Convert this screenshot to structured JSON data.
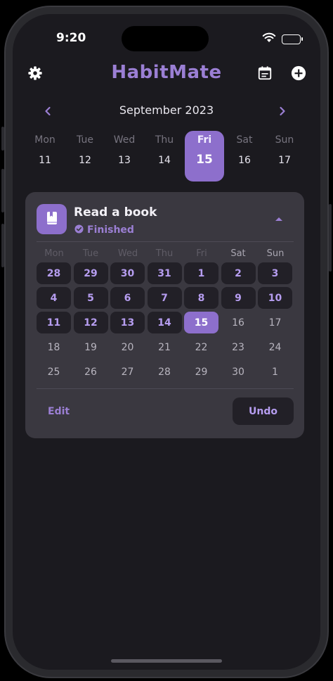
{
  "status_bar": {
    "time": "9:20"
  },
  "header": {
    "title": "HabitMate",
    "left_icon": "gear-icon",
    "right_icons": [
      "calendar-icon",
      "plus-circle-icon"
    ]
  },
  "month_nav": {
    "label": "September 2023",
    "prev_icon": "chevron-left-icon",
    "next_icon": "chevron-right-icon"
  },
  "week_strip": {
    "days": [
      {
        "name": "Mon",
        "date": "11"
      },
      {
        "name": "Tue",
        "date": "12"
      },
      {
        "name": "Wed",
        "date": "13"
      },
      {
        "name": "Thu",
        "date": "14"
      },
      {
        "name": "Fri",
        "date": "15",
        "selected": true
      },
      {
        "name": "Sat",
        "date": "16"
      },
      {
        "name": "Sun",
        "date": "17"
      }
    ]
  },
  "habit_card": {
    "icon": "book-icon",
    "name": "Read a book",
    "status": "Finished",
    "status_icon": "check-circle-icon",
    "weekdays": [
      "Mon",
      "Tue",
      "Wed",
      "Thu",
      "Fri",
      "Sat",
      "Sun"
    ],
    "calendar_rows": [
      [
        {
          "d": "28",
          "s": "done"
        },
        {
          "d": "29",
          "s": "done"
        },
        {
          "d": "30",
          "s": "done"
        },
        {
          "d": "31",
          "s": "done"
        },
        {
          "d": "1",
          "s": "done"
        },
        {
          "d": "2",
          "s": "done"
        },
        {
          "d": "3",
          "s": "done"
        }
      ],
      [
        {
          "d": "4",
          "s": "done"
        },
        {
          "d": "5",
          "s": "done"
        },
        {
          "d": "6",
          "s": "done"
        },
        {
          "d": "7",
          "s": "done"
        },
        {
          "d": "8",
          "s": "done"
        },
        {
          "d": "9",
          "s": "done"
        },
        {
          "d": "10",
          "s": "done"
        }
      ],
      [
        {
          "d": "11",
          "s": "done"
        },
        {
          "d": "12",
          "s": "done"
        },
        {
          "d": "13",
          "s": "done"
        },
        {
          "d": "14",
          "s": "done"
        },
        {
          "d": "15",
          "s": "today"
        },
        {
          "d": "16",
          "s": "future"
        },
        {
          "d": "17",
          "s": "future"
        }
      ],
      [
        {
          "d": "18",
          "s": "future"
        },
        {
          "d": "19",
          "s": "future"
        },
        {
          "d": "20",
          "s": "future"
        },
        {
          "d": "21",
          "s": "future"
        },
        {
          "d": "22",
          "s": "future"
        },
        {
          "d": "23",
          "s": "future"
        },
        {
          "d": "24",
          "s": "future"
        }
      ],
      [
        {
          "d": "25",
          "s": "future"
        },
        {
          "d": "26",
          "s": "future"
        },
        {
          "d": "27",
          "s": "future"
        },
        {
          "d": "28",
          "s": "future"
        },
        {
          "d": "29",
          "s": "future"
        },
        {
          "d": "30",
          "s": "future"
        },
        {
          "d": "1",
          "s": "future"
        }
      ]
    ],
    "edit_label": "Edit",
    "undo_label": "Undo"
  },
  "colors": {
    "accent": "#8d6fcc",
    "accent_text": "#9b7fd4",
    "background": "#1b1a1f",
    "card": "#3a3840"
  }
}
